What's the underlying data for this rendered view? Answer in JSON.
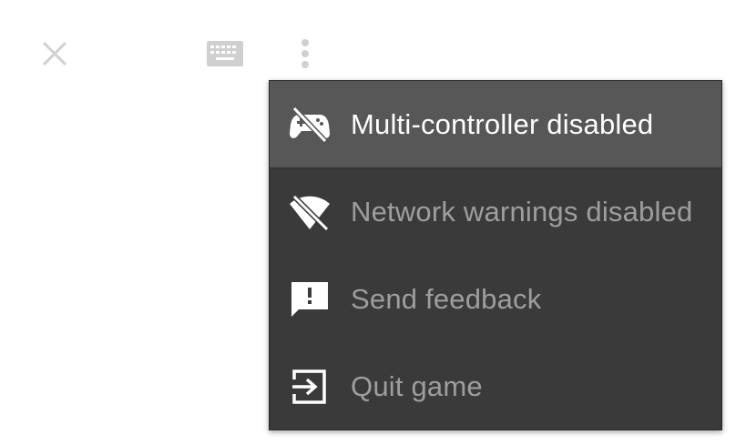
{
  "toolbar": {
    "close_icon": "close-icon",
    "keyboard_icon": "keyboard-icon",
    "more_icon": "more-vertical-icon"
  },
  "menu": {
    "items": [
      {
        "label": "Multi-controller disabled",
        "icon": "gamepad-off-icon",
        "active": true
      },
      {
        "label": "Network warnings disabled",
        "icon": "wifi-off-icon",
        "active": false
      },
      {
        "label": "Send feedback",
        "icon": "feedback-icon",
        "active": false
      },
      {
        "label": "Quit game",
        "icon": "exit-icon",
        "active": false
      }
    ]
  },
  "colors": {
    "menu_background": "#3a3a3a",
    "active_item_background": "#575757",
    "active_text": "#ffffff",
    "inactive_text": "#9e9e9e",
    "toolbar_icon": "#cfcfcf"
  }
}
